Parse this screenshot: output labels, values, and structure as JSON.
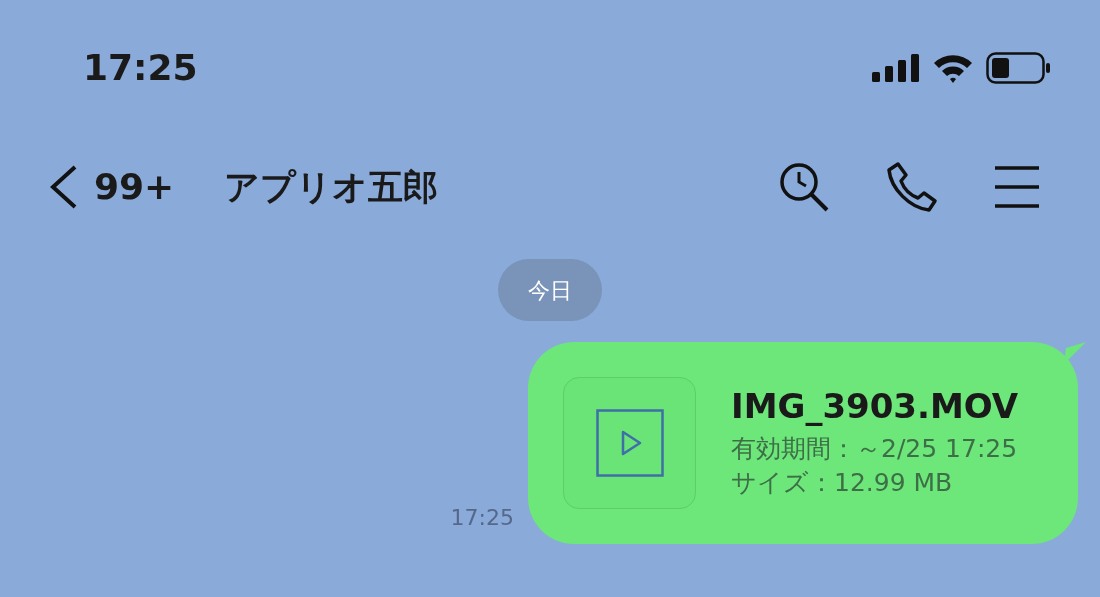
{
  "status_bar": {
    "time": "17:25"
  },
  "header": {
    "back_count": "99+",
    "title": "アプリオ五郎"
  },
  "date_chip": "今日",
  "messages": [
    {
      "kind": "file",
      "sent_time": "17:25",
      "file_name": "IMG_3903.MOV",
      "expiry": "有効期間：～2/25 17:25",
      "size": "サイズ：12.99 MB"
    }
  ]
}
